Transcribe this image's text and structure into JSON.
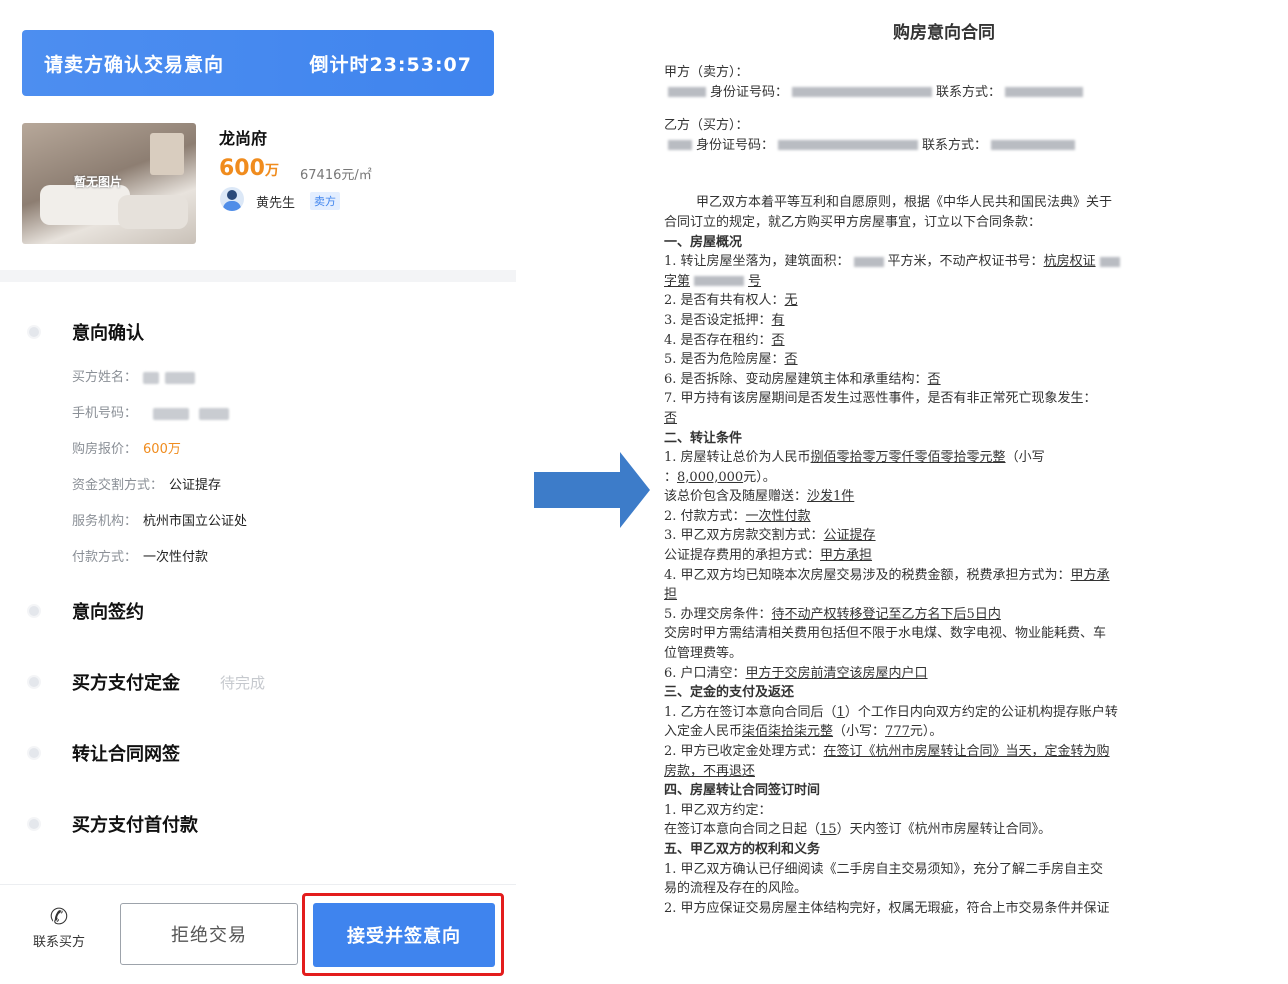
{
  "banner": {
    "title": "请卖方确认交易意向",
    "countdown": "倒计时23:53:07"
  },
  "property": {
    "no_image_label": "暂无图片",
    "name": "龙尚府",
    "price_number": "600",
    "price_unit": "万",
    "unit_price": "67416元/㎡",
    "seller_name": "黄先生",
    "seller_tag": "卖方"
  },
  "steps": [
    {
      "label": "意向确认"
    },
    {
      "label": "意向签约"
    },
    {
      "label": "买方支付定金",
      "status": "待完成"
    },
    {
      "label": "转让合同网签"
    },
    {
      "label": "买方支付首付款"
    }
  ],
  "fields": {
    "buyer_name_label": "买方姓名",
    "phone_label": "手机号码",
    "offer_label": "购房报价",
    "offer_value": "600万",
    "fund_method_label": "资金交割方式",
    "fund_method_value": "公证提存",
    "agency_label": "服务机构",
    "agency_value": "杭州市国立公证处",
    "payment_label": "付款方式",
    "payment_value": "一次性付款"
  },
  "actions": {
    "contact": "联系买方",
    "reject": "拒绝交易",
    "accept": "接受并签意向"
  },
  "document": {
    "title": "购房意向合同",
    "party_a": "甲方（卖方）：",
    "id_label": "身份证号码：",
    "contact_label": "联系方式：",
    "party_b": "乙方（买方）：",
    "intro1": "甲乙双方本着平等互利和自愿原则，根据《中华人民共和国民法典》关于",
    "intro2": "合同订立的规定，就乙方购买甲方房屋事宜，订立以下合同条款：",
    "s1": "一、房屋概况",
    "s1_1a": "1. 转让房屋坐落为，建筑面积：",
    "s1_1b": "平方米，不动产权证书号：",
    "s1_1c": "杭房权证",
    "s1_1d": "字第",
    "s1_1e": "号",
    "s1_2": "2. 是否有共有权人：",
    "s1_2v": "无",
    "s1_3": "3. 是否设定抵押：",
    "s1_3v": "有",
    "s1_4": "4. 是否存在租约：",
    "s1_4v": "否",
    "s1_5": "5. 是否为危险房屋：",
    "s1_5v": "否",
    "s1_6": "6. 是否拆除、变动房屋建筑主体和承重结构：",
    "s1_6v": "否",
    "s1_7": "7. 甲方持有该房屋期间是否发生过恶性事件，是否有非正常死亡现象发生：",
    "s1_7v": "否",
    "s2": "二、转让条件",
    "s2_1a": "1. 房屋转让总价为人民币",
    "s2_1b": "捌佰零拾零万零仟零佰零拾零元整",
    "s2_1c": "（小写",
    "s2_1d": "：",
    "s2_1e": "8,000,000",
    "s2_1f": "元）。",
    "s2_1g": "该总价包含及随屋赠送：",
    "s2_1h": "沙发1件",
    "s2_2": "2. 付款方式：",
    "s2_2v": "一次性付款",
    "s2_3": "3. 甲乙双方房款交割方式：",
    "s2_3v": "公证提存",
    "s2_3b": "公证提存费用的承担方式：",
    "s2_3bv": "甲方承担",
    "s2_4": "4. 甲乙双方均已知晓本次房屋交易涉及的税费金额，税费承担方式为：",
    "s2_4v": "甲方承",
    "s2_4v2": "担",
    "s2_5": "5. 办理交房条件：",
    "s2_5v": "待不动产权转移登记至乙方名下后5日内",
    "s2_5b": "交房时甲方需结清相关费用包括但不限于水电煤、数字电视、物业能耗费、车",
    "s2_5c": "位管理费等。",
    "s2_6": "6. 户口清空：",
    "s2_6v": "甲方于交房前清空该房屋内户口",
    "s3": "三、定金的支付及返还",
    "s3_1a": "1. 乙方在签订本意向合同后（",
    "s3_1b": "1",
    "s3_1c": "）个工作日内向双方约定的公证机构提存账户转",
    "s3_1d": "入定金人民币",
    "s3_1e": "柒佰柒拾柒元整",
    "s3_1f": "（小写：",
    "s3_1g": "777",
    "s3_1h": "元）。",
    "s3_2a": "2. 甲方已收定金处理方式：",
    "s3_2b": "在签订《杭州市房屋转让合同》当天，定金转为购",
    "s3_2c": "房款，不再退还",
    "s4": "四、房屋转让合同签订时间",
    "s4_1": "1.   甲乙双方约定：",
    "s4_2a": "在签订本意向合同之日起（",
    "s4_2b": "15",
    "s4_2c": "）天内签订《杭州市房屋转让合同》。",
    "s5": "五、甲乙双方的权利和义务",
    "s5_1": "1. 甲乙双方确认已仔细阅读《二手房自主交易须知》，充分了解二手房自主交",
    "s5_1b": "易的流程及存在的风险。",
    "s5_2": "2. 甲方应保证交易房屋主体结构完好，权属无瑕疵，符合上市交易条件并保证"
  },
  "colors": {
    "primary": "#3f84ee",
    "price": "#f08c1e",
    "highlight": "#e31c1c"
  }
}
